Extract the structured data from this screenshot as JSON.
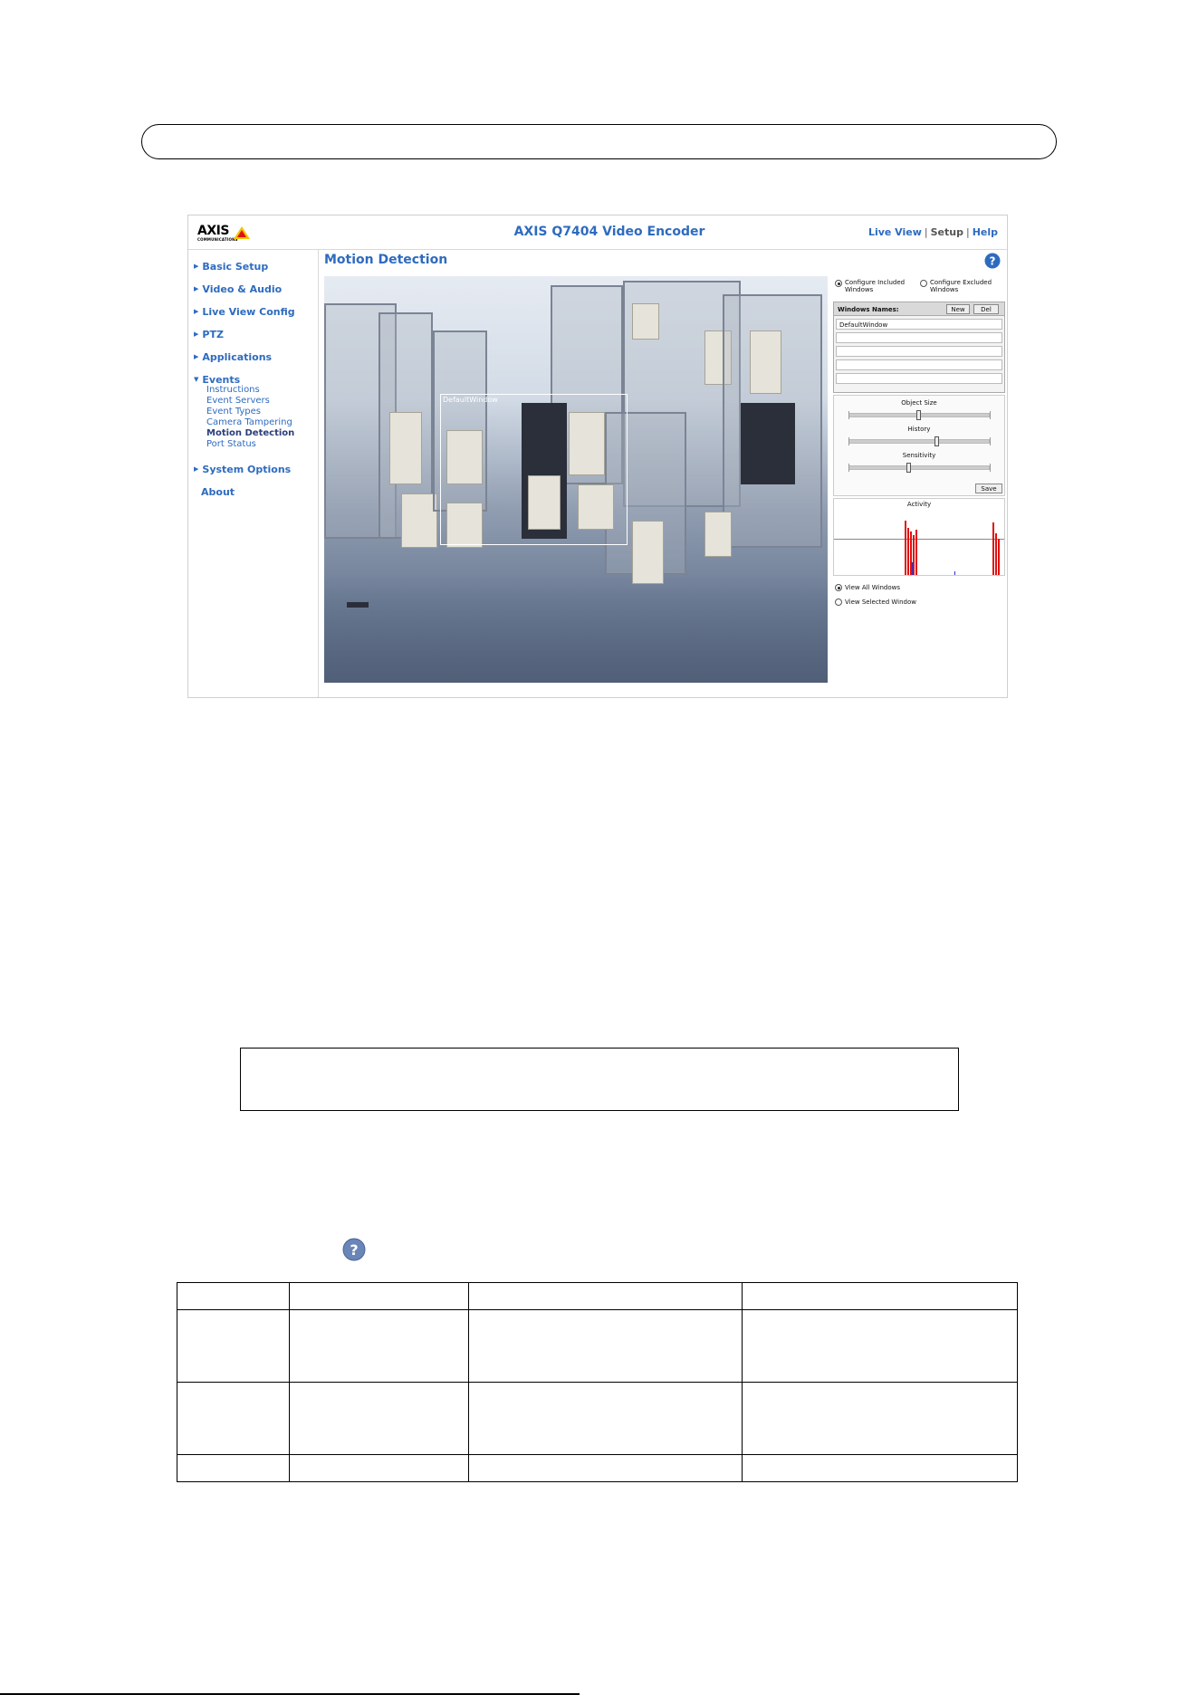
{
  "ui": {
    "brand": {
      "logo_word": "AXIS",
      "logo_sub": "COMMUNICATIONS",
      "product_title": "AXIS Q7404 Video Encoder"
    },
    "top_links": [
      {
        "label": "Live View"
      },
      {
        "label": "Setup"
      },
      {
        "label": "Help"
      }
    ],
    "top_sep": "|",
    "sidebar": {
      "main_items": [
        {
          "label": "Basic Setup"
        },
        {
          "label": "Video & Audio"
        },
        {
          "label": "Live View Config"
        },
        {
          "label": "PTZ"
        },
        {
          "label": "Applications"
        },
        {
          "label": "Events"
        },
        {
          "label": "System Options"
        },
        {
          "label": "About"
        }
      ],
      "event_sub_items": [
        {
          "label": "Instructions"
        },
        {
          "label": "Event Servers"
        },
        {
          "label": "Event Types"
        },
        {
          "label": "Camera Tampering"
        },
        {
          "label": "Motion Detection"
        },
        {
          "label": "Port Status"
        }
      ]
    },
    "page_title": "Motion Detection",
    "help_glyph": "?",
    "camera": {
      "window_label": "DefaultWindow"
    },
    "right_panel": {
      "radio_included": "Configure Included Windows",
      "radio_excluded": "Configure Excluded Windows",
      "windows_names_label": "Windows Names:",
      "new_button": "New",
      "del_button": "Del",
      "window_rows": [
        "DefaultWindow",
        "",
        "",
        "",
        ""
      ],
      "sliders": [
        {
          "label": "Object Size",
          "value": 0.5
        },
        {
          "label": "History",
          "value": 0.63
        },
        {
          "label": "Sensitivity",
          "value": 0.43
        }
      ],
      "save_button": "Save",
      "activity_label": "Activity",
      "view_all": "View All Windows",
      "view_selected": "View Selected Window"
    }
  },
  "colors": {
    "link_blue": "#2e6bbf",
    "selected_nav": "#2a3f7a",
    "activity_red": "#e01010",
    "activity_blue": "#3030c0"
  },
  "doc": {
    "help_glyph": "?"
  }
}
